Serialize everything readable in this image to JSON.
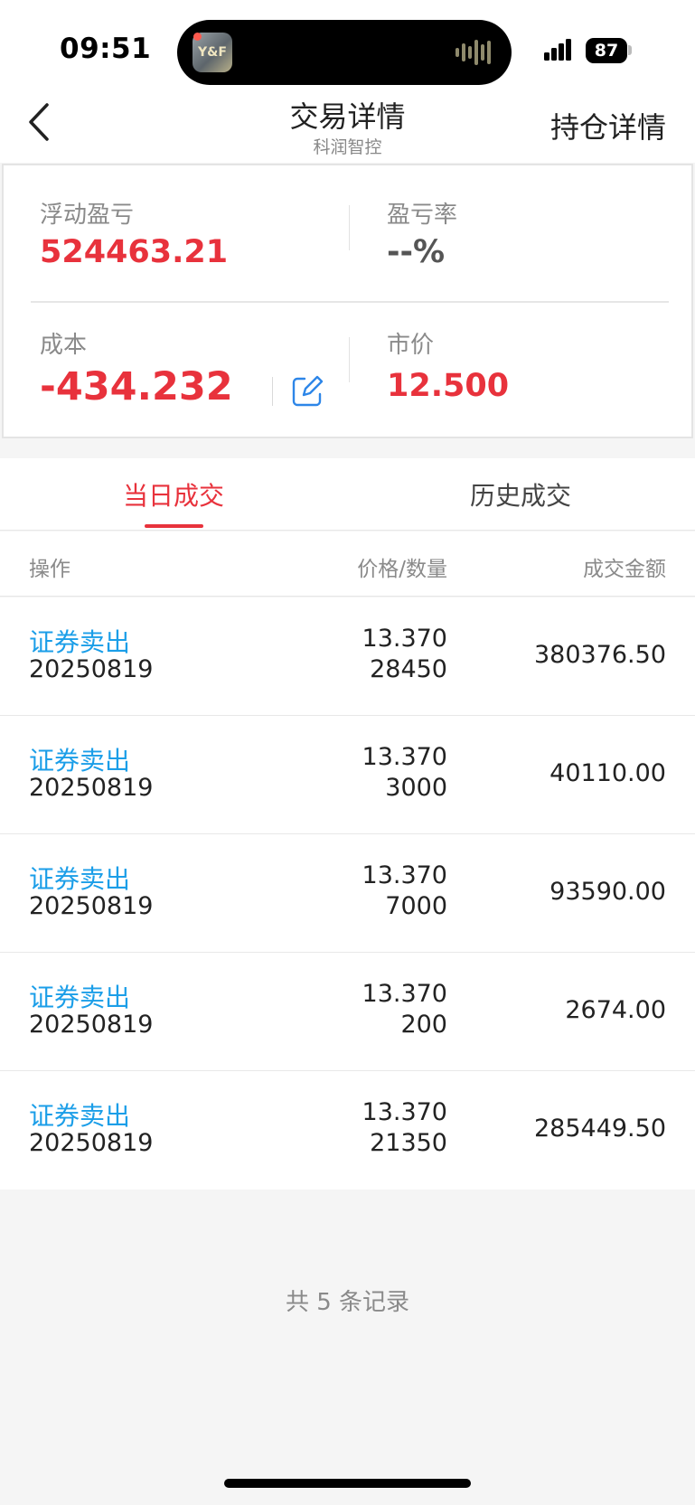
{
  "status": {
    "time": "09:51",
    "battery": "87",
    "app_badge": "Y&F"
  },
  "nav": {
    "title": "交易详情",
    "subtitle": "科润智控",
    "right_action": "持仓详情"
  },
  "summary": {
    "floating_pl_label": "浮动盈亏",
    "floating_pl_value": "524463.21",
    "pl_rate_label": "盈亏率",
    "pl_rate_value": "--%",
    "cost_label": "成本",
    "cost_value": "-434.232",
    "market_price_label": "市价",
    "market_price_value": "12.500",
    "colors": {
      "positive": "#e8323c",
      "neutral": "#555555"
    }
  },
  "tabs": [
    {
      "label": "当日成交",
      "active": true
    },
    {
      "label": "历史成交",
      "active": false
    }
  ],
  "table": {
    "headers": {
      "operation": "操作",
      "price_qty": "价格/数量",
      "amount": "成交金额"
    },
    "rows": [
      {
        "operation": "证券卖出",
        "date": "20250819",
        "price": "13.370",
        "quantity": "28450",
        "amount": "380376.50"
      },
      {
        "operation": "证券卖出",
        "date": "20250819",
        "price": "13.370",
        "quantity": "3000",
        "amount": "40110.00"
      },
      {
        "operation": "证券卖出",
        "date": "20250819",
        "price": "13.370",
        "quantity": "7000",
        "amount": "93590.00"
      },
      {
        "operation": "证券卖出",
        "date": "20250819",
        "price": "13.370",
        "quantity": "200",
        "amount": "2674.00"
      },
      {
        "operation": "证券卖出",
        "date": "20250819",
        "price": "13.370",
        "quantity": "21350",
        "amount": "285449.50"
      }
    ]
  },
  "footer": {
    "record_count_text": "共 5 条记录"
  },
  "icons": {
    "back": "chevron-left-icon",
    "edit": "edit-icon",
    "signal": "signal-icon",
    "battery": "battery-icon",
    "audio": "audio-wave-icon"
  },
  "accent": {
    "red": "#e8323c",
    "blue": "#1b9ee8"
  }
}
